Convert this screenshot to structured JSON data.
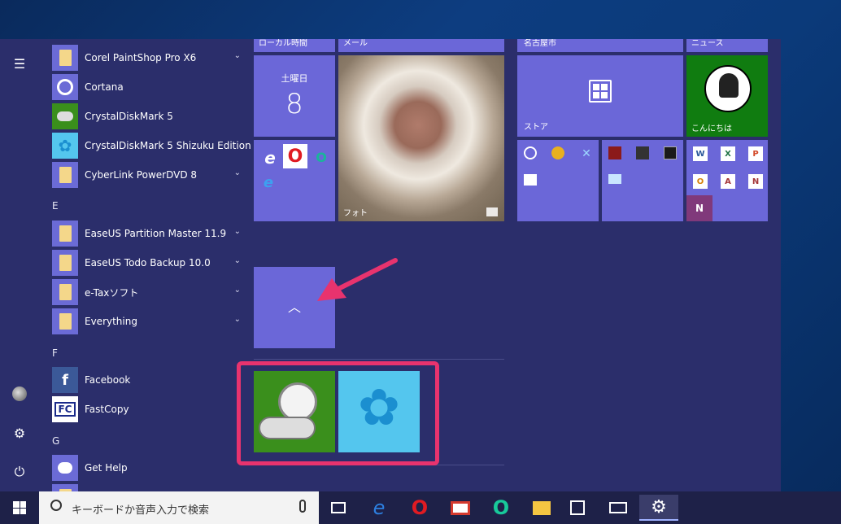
{
  "start_menu": {
    "rail": {
      "hamburger": "☰",
      "settings": "⚙",
      "power": "⏻"
    },
    "app_list": [
      {
        "label": "Corel PaintShop Pro X6",
        "chevron": true,
        "icon": "folder-icon"
      },
      {
        "label": "Cortana",
        "chevron": false,
        "icon": "cortana-icon"
      },
      {
        "label": "CrystalDiskMark 5",
        "chevron": false,
        "icon": "crystaldiskmark-icon"
      },
      {
        "label": "CrystalDiskMark 5 Shizuku Edition",
        "chevron": false,
        "icon": "shizuku-icon"
      },
      {
        "label": "CyberLink PowerDVD 8",
        "chevron": true,
        "icon": "folder-icon"
      },
      {
        "label": "EaseUS Partition Master 11.9",
        "chevron": true,
        "icon": "folder-icon"
      },
      {
        "label": "EaseUS Todo Backup 10.0",
        "chevron": true,
        "icon": "folder-icon"
      },
      {
        "label": "e-Taxソフト",
        "chevron": true,
        "icon": "folder-icon"
      },
      {
        "label": "Everything",
        "chevron": true,
        "icon": "folder-icon"
      },
      {
        "label": "Facebook",
        "chevron": false,
        "icon": "facebook-icon"
      },
      {
        "label": "FastCopy",
        "chevron": false,
        "icon": "fastcopy-icon"
      },
      {
        "label": "Get Help",
        "chevron": false,
        "icon": "get-help-icon"
      }
    ],
    "letters": {
      "e": "E",
      "f": "F",
      "g": "G"
    },
    "tiles": {
      "top_clip_left": "ローカル時間",
      "top_clip_mid": "メール",
      "top_clip_right": "名古屋市",
      "top_clip_news": "ニュース",
      "calendar_day": "土曜日",
      "calendar_date": "8",
      "photos_label": "フォト",
      "store_label": "ストア",
      "character_label": "こんにちは",
      "collapse_glyph": "︿"
    },
    "office": [
      "W",
      "X",
      "P",
      "O",
      "A",
      "N",
      "N"
    ]
  },
  "taskbar": {
    "search_placeholder": "キーボードか音声入力で検索",
    "start_icon": "windows-logo-icon"
  },
  "colors": {
    "tile": "#6b67d8",
    "menu_bg": "#2b2e6b",
    "highlight": "#e8336e",
    "green_tile": "#3a8f1c"
  }
}
